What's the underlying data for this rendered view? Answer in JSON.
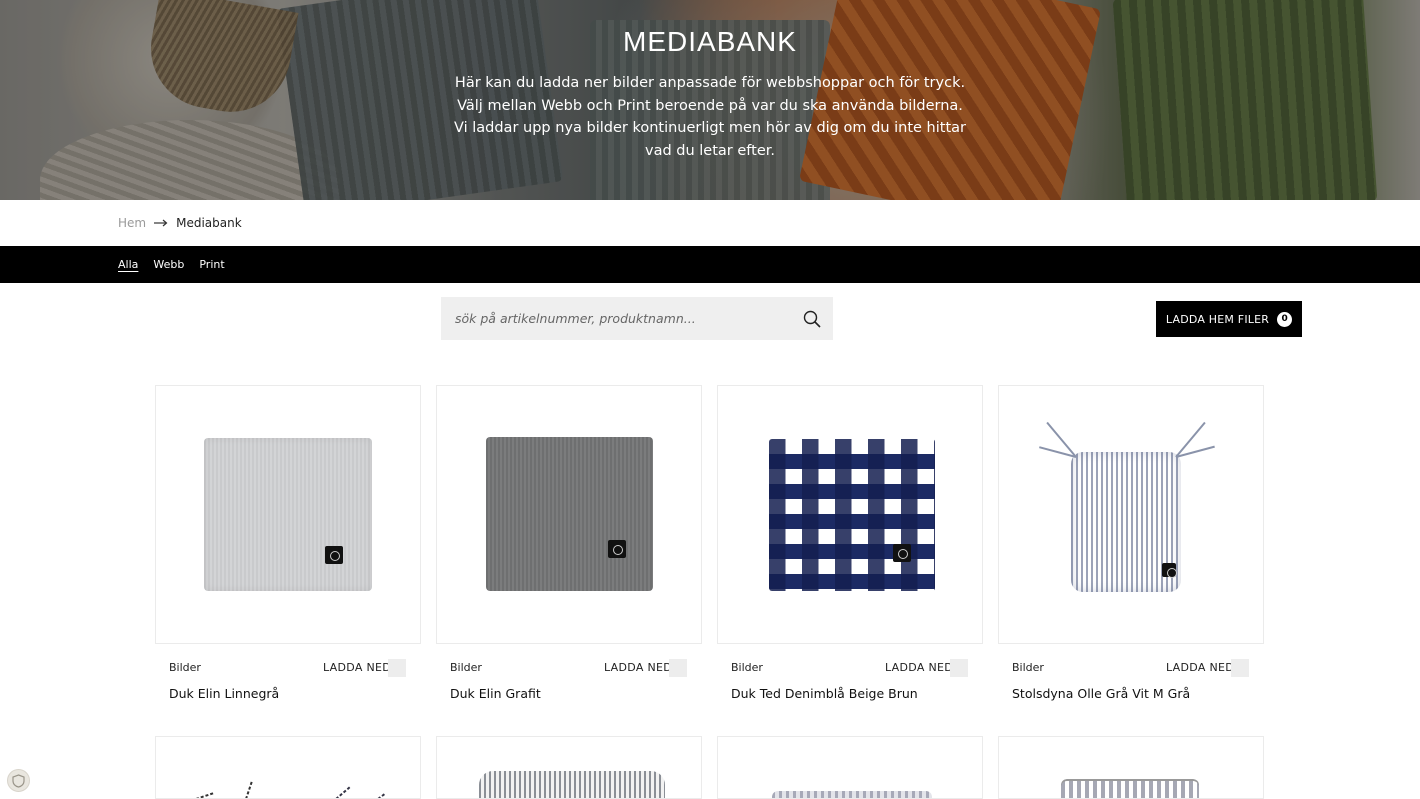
{
  "hero": {
    "title": "MEDIABANK",
    "description": "Här kan du ladda ner bilder anpassade för webbshoppar och för tryck. Välj mellan Webb och Print beroende på var du ska använda bilderna. Vi laddar upp nya bilder kontinuerligt men hör av dig om du inte hittar vad du letar efter."
  },
  "breadcrumb": {
    "home": "Hem",
    "current": "Mediabank",
    "separator_icon": "arrow-right-icon"
  },
  "filter_tabs": [
    {
      "label": "Alla",
      "active": true
    },
    {
      "label": "Webb",
      "active": false
    },
    {
      "label": "Print",
      "active": false
    }
  ],
  "search": {
    "placeholder": "sök på artikelnummer, produktnamn...",
    "value": "",
    "icon": "search-icon"
  },
  "download_button": {
    "label": "LADDA HEM FILER",
    "count": "0"
  },
  "products": [
    {
      "type": "Bilder",
      "download_label": "LADDA NED",
      "name": "Duk Elin Linnegrå"
    },
    {
      "type": "Bilder",
      "download_label": "LADDA NED",
      "name": "Duk Elin Grafit"
    },
    {
      "type": "Bilder",
      "download_label": "LADDA NED",
      "name": "Duk Ted Denimblå Beige Brun"
    },
    {
      "type": "Bilder",
      "download_label": "LADDA NED",
      "name": "Stolsdyna Olle Grå Vit M Grå"
    }
  ],
  "colors": {
    "filter_bar": "#000000",
    "button_bg": "#000000",
    "search_bg": "#efefef",
    "card_border": "#ebebeb"
  }
}
